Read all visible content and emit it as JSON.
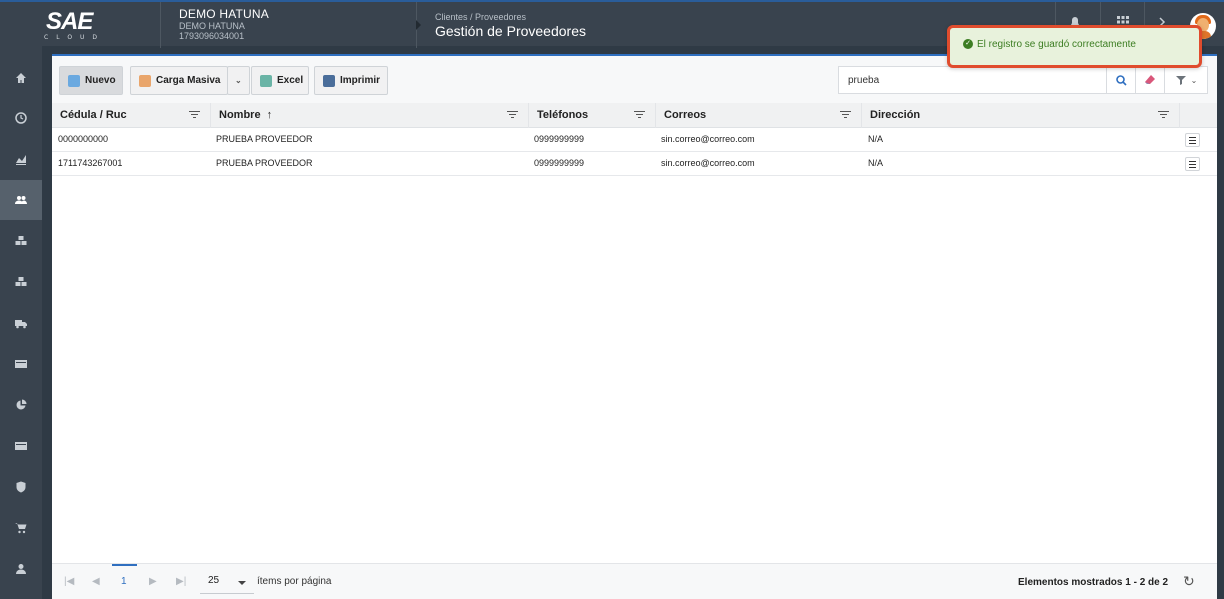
{
  "app": {
    "logo_text": "SAE",
    "logo_sub": "CLOUD"
  },
  "company": {
    "name": "DEMO HATUNA",
    "sub_name": "DEMO HATUNA",
    "ruc": "1793096034001"
  },
  "breadcrumb": {
    "path": "Clientes / Proveedores",
    "title": "Gestión de Proveedores"
  },
  "sidebar": {
    "items": [
      {
        "icon": "home-icon"
      },
      {
        "icon": "clock-icon"
      },
      {
        "icon": "chart-icon"
      },
      {
        "icon": "users-icon",
        "active": true
      },
      {
        "icon": "boxes-icon"
      },
      {
        "icon": "boxes-icon"
      },
      {
        "icon": "truck-icon"
      },
      {
        "icon": "card-icon"
      },
      {
        "icon": "pie-icon"
      },
      {
        "icon": "card-icon"
      },
      {
        "icon": "shield-icon"
      },
      {
        "icon": "cart-icon"
      },
      {
        "icon": "user-tie-icon"
      }
    ]
  },
  "toolbar": {
    "new_label": "Nuevo",
    "bulk_label": "Carga Masiva",
    "excel_label": "Excel",
    "print_label": "Imprimir"
  },
  "search": {
    "value": "prueba"
  },
  "table": {
    "columns": [
      "Cédula / Ruc",
      "Nombre",
      "Teléfonos",
      "Correos",
      "Dirección"
    ],
    "sort_indicator": "↑",
    "rows": [
      {
        "ruc": "0000000000",
        "name": "PRUEBA PROVEEDOR",
        "phone": "0999999999",
        "email": "sin.correo@correo.com",
        "address": "N/A"
      },
      {
        "ruc": "1711743267001",
        "name": "PRUEBA PROVEEDOR",
        "phone": "0999999999",
        "email": "sin.correo@correo.com",
        "address": "N/A"
      }
    ]
  },
  "pager": {
    "current_page": "1",
    "page_size": "25",
    "page_size_label": "ítems por página",
    "shown_text": "Elementos mostrados 1 - 2 de 2"
  },
  "toast": {
    "message": "El registro se guardó correctamente"
  },
  "colors": {
    "accent": "#2f6fc0",
    "success": "#3c7d22",
    "toast_border": "#e04c2d"
  }
}
